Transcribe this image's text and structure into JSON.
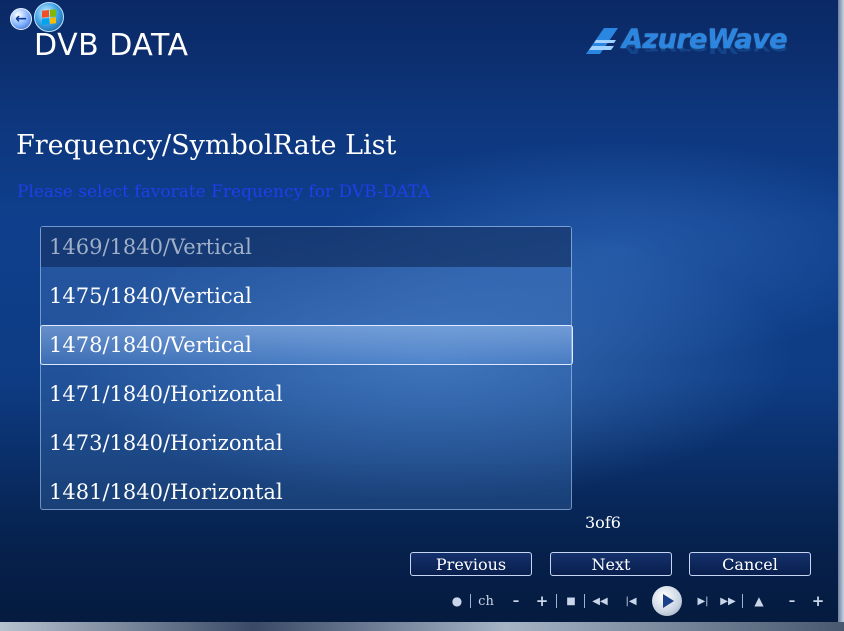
{
  "header": {
    "app_title": "DVB DATA",
    "brand": "AzureWave",
    "icons": {
      "back": "back-arrow-icon",
      "start": "windows-orb-icon"
    }
  },
  "main": {
    "title": "Frequency/SymbolRate List",
    "subtitle": "Please select favorate Frequency for DVB-DATA",
    "items": [
      {
        "label": "1469/1840/Vertical",
        "state": "dim"
      },
      {
        "label": "1475/1840/Vertical",
        "state": "normal"
      },
      {
        "label": "1478/1840/Vertical",
        "state": "selected"
      },
      {
        "label": "1471/1840/Horizontal",
        "state": "normal"
      },
      {
        "label": "1473/1840/Horizontal",
        "state": "normal"
      },
      {
        "label": "1481/1840/Horizontal",
        "state": "normal"
      }
    ],
    "page_count": "3of6"
  },
  "buttons": {
    "previous": "Previous",
    "next": "Next",
    "cancel": "Cancel"
  },
  "transport": {
    "channel_label": "ch",
    "icons": [
      "record-icon",
      "channel-down-icon",
      "channel-up-icon",
      "stop-icon",
      "rewind-icon",
      "skip-back-icon",
      "play-icon",
      "skip-forward-icon",
      "fast-forward-icon",
      "mute-icon",
      "volume-down-icon",
      "volume-up-icon"
    ]
  },
  "colors": {
    "subtitle": "#1f3fe8",
    "brand": "#2a86e0",
    "background": "#0f3f8c"
  }
}
